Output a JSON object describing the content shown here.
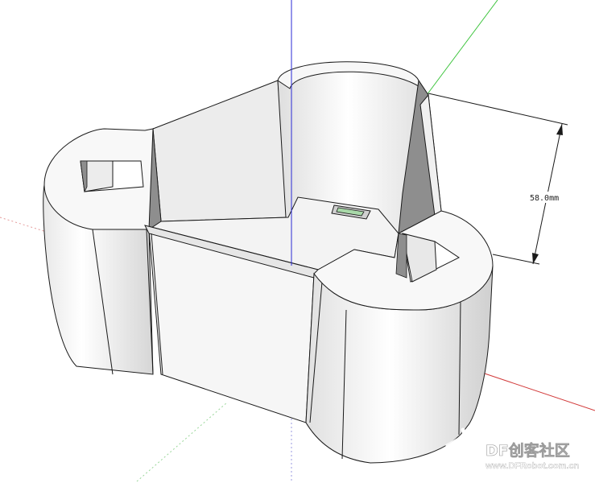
{
  "viewport": {
    "axis_colors": {
      "blue": "#2a2ad6",
      "green": "#3cc43c",
      "red": "#d23a3a"
    }
  },
  "model": {
    "face_color": "#f4f4f4",
    "shade_color": "#d9d9d9",
    "dark_color": "#8e8e8e",
    "edge_color": "#1a1a1a"
  },
  "dimension": {
    "label": "58.0mm"
  },
  "watermark": {
    "brand": "DF创客社区",
    "url": "www.DFRobot.com.cn",
    "icon": "robot-logo-icon"
  }
}
